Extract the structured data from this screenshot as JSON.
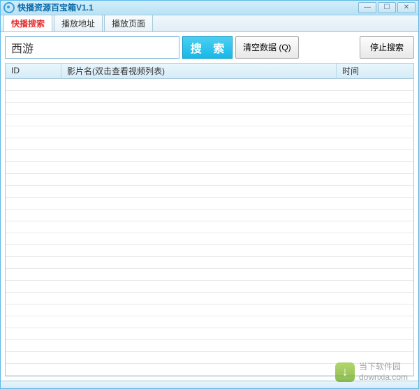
{
  "window": {
    "title": "快播资源百宝箱V1.1"
  },
  "tabs": [
    {
      "label": "快播搜索",
      "active": true
    },
    {
      "label": "播放地址",
      "active": false
    },
    {
      "label": "播放页面",
      "active": false
    }
  ],
  "search": {
    "input_value": "西游",
    "search_label": "搜 索",
    "clear_label": "清空数据 (Q)",
    "stop_label": "停止搜索"
  },
  "table": {
    "col_id": "ID",
    "col_name": "影片名(双击查看视频列表)",
    "col_time": "时间",
    "rows": []
  },
  "watermark": {
    "site_name": "当下软件园",
    "site_url": "downxia.com"
  }
}
